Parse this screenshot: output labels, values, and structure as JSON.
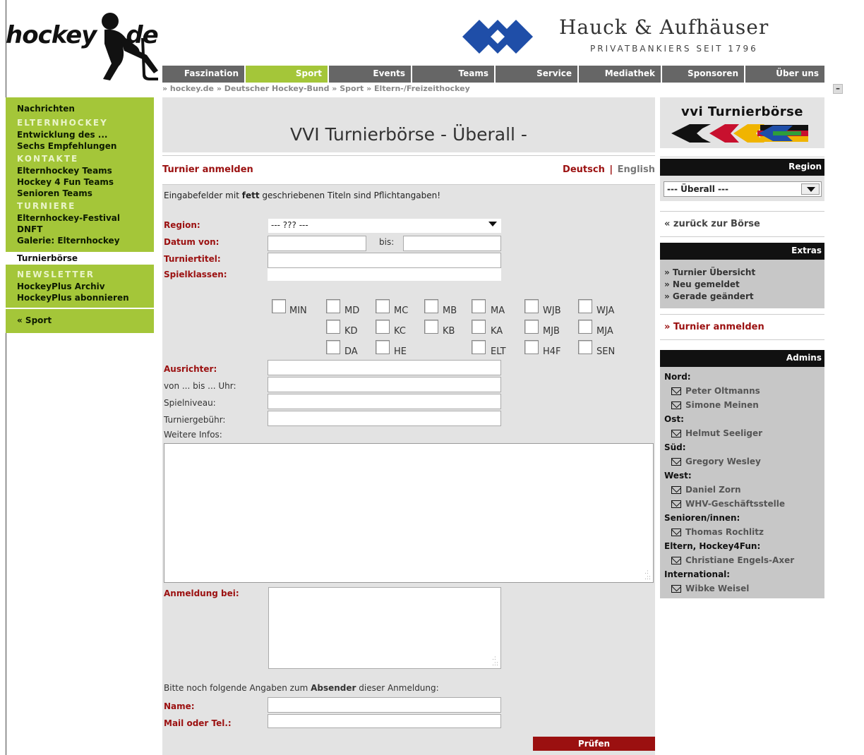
{
  "header": {
    "logo_text_left": "hockey",
    "logo_text_right": "de",
    "bank_name": "Hauck & Aufhäuser",
    "bank_subtitle": "PRIVATBANKIERS SEIT 1796"
  },
  "topnav": {
    "tabs": [
      {
        "label": "Faszination",
        "active": false
      },
      {
        "label": "Sport",
        "active": true
      },
      {
        "label": "Events",
        "active": false
      },
      {
        "label": "Teams",
        "active": false
      },
      {
        "label": "Service",
        "active": false
      },
      {
        "label": "Mediathek",
        "active": false
      },
      {
        "label": "Sponsoren",
        "active": false
      },
      {
        "label": "Über uns",
        "active": false
      }
    ],
    "collapse_label": "–"
  },
  "breadcrumb": "» hockey.de » Deutscher Hockey-Bund » Sport » Eltern-/Freizeithockey",
  "sidebar": {
    "nachrichten": "Nachrichten",
    "cat_elternhockey": "ELTERNHOCKEY",
    "entwicklung": "Entwicklung des ...",
    "empfehlungen": "Sechs Empfehlungen",
    "cat_kontakte": "KONTAKTE",
    "elternhockey_teams": "Elternhockey Teams",
    "hockey4fun_teams": "Hockey 4 Fun Teams",
    "senioren_teams": "Senioren Teams",
    "cat_turniere": "TURNIERE",
    "festival": "Elternhockey-Festival",
    "dnft": "DNFT",
    "galerie": "Galerie: Elternhockey",
    "turnierboerse": "Turnierbörse",
    "cat_newsletter": "NEWSLETTER",
    "archiv": "HockeyPlus Archiv",
    "abonnieren": "HockeyPlus abonnieren",
    "back_sport": "« Sport"
  },
  "main": {
    "title": "VVI Turnierbörse - Überall -",
    "register_title": "Turnier anmelden",
    "lang_de": "Deutsch",
    "lang_sep": "|",
    "lang_en": "English",
    "note_pre": "Eingabefelder mit ",
    "note_bold": "fett",
    "note_post": " geschriebenen Titeln sind Pflichtangaben!",
    "labels": {
      "region": "Region:",
      "datum_von": "Datum von:",
      "bis": "bis:",
      "turniertitel": "Turniertitel:",
      "spielklassen": "Spielklassen:",
      "ausrichter": "Ausrichter:",
      "uhrzeit": "von ... bis ... Uhr:",
      "spielniveau": "Spielniveau:",
      "turniergebuehr": "Turniergebühr:",
      "weitere_infos": "Weitere Infos:",
      "anmeldung_bei": "Anmeldung bei:",
      "sender_pre": "Bitte noch folgende Angaben zum ",
      "sender_bold": "Absender",
      "sender_post": " dieser Anmeldung:",
      "name": "Name:",
      "mail": "Mail oder Tel.:"
    },
    "region_value": "--- ??? ---",
    "classes": [
      "MIN",
      "MD",
      "MC",
      "MB",
      "MA",
      "WJB",
      "WJA",
      "KD",
      "KC",
      "KB",
      "KA",
      "MJB",
      "MJA",
      "DA",
      "HE",
      "ELT",
      "H4F",
      "SEN"
    ],
    "submit": "Prüfen"
  },
  "right": {
    "banner_title": "vvi Turnierbörse",
    "region_head": "Region",
    "region_value": "--- Überall ---",
    "back_link": "« zurück zur Börse",
    "extras_head": "Extras",
    "extras": [
      "» Turnier Übersicht",
      "» Neu gemeldet",
      "» Gerade geändert"
    ],
    "register_link": "» Turnier anmelden",
    "admins_head": "Admins",
    "admins": [
      {
        "cat": "Nord:",
        "people": [
          "Peter Oltmanns",
          "Simone Meinen"
        ]
      },
      {
        "cat": "Ost:",
        "people": [
          "Helmut Seeliger"
        ]
      },
      {
        "cat": "Süd:",
        "people": [
          "Gregory Wesley"
        ]
      },
      {
        "cat": "West:",
        "people": [
          "Daniel Zorn",
          "WHV-Geschäftsstelle"
        ]
      },
      {
        "cat": "Senioren/innen:",
        "people": [
          "Thomas Rochlitz"
        ]
      },
      {
        "cat": "Eltern, Hockey4Fun:",
        "people": [
          "Christiane Engels-Axer"
        ]
      },
      {
        "cat": "International:",
        "people": [
          "Wibke Weisel"
        ]
      }
    ]
  },
  "colors": {
    "green": "#a4c639",
    "darkred": "#9b1010",
    "navgray": "#666666",
    "panel": "#e3e3e3"
  }
}
